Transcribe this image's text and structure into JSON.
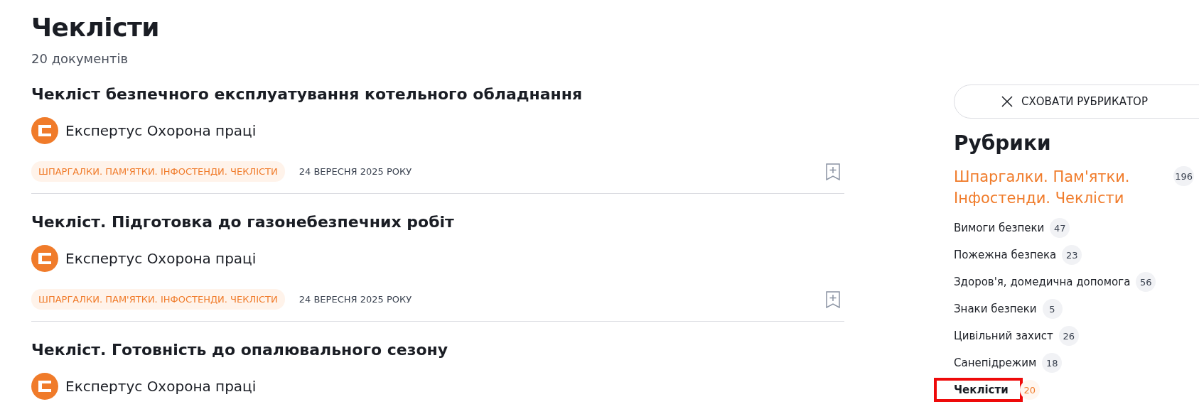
{
  "page": {
    "title": "Чеклісти",
    "subtitle": "20 документів"
  },
  "articles": [
    {
      "title": "Чекліст безпечного експлуатування котельного обладнання",
      "source": "Експертус Охорона праці",
      "tag": "ШПАРГАЛКИ. ПАМ'ЯТКИ. ІНФОСТЕНДИ. ЧЕКЛІСТИ",
      "date": "24 ВЕРЕСНЯ 2025 РОКУ"
    },
    {
      "title": "Чекліст. Підготовка до газонебезпечних робіт",
      "source": "Експертус Охорона праці",
      "tag": "ШПАРГАЛКИ. ПАМ'ЯТКИ. ІНФОСТЕНДИ. ЧЕКЛІСТИ",
      "date": "24 ВЕРЕСНЯ 2025 РОКУ"
    },
    {
      "title": "Чекліст. Готовність до опалювального сезону",
      "source": "Експертус Охорона праці"
    }
  ],
  "sidebar": {
    "hide_button": "СХОВАТИ РУБРИКАТОР",
    "heading": "Рубрики",
    "parent": {
      "label": "Шпаргалки. Пам'ятки. Інфостенди. Чеклісти",
      "count": "196"
    },
    "items": [
      {
        "label": "Вимоги безпеки",
        "count": "47",
        "selected": false
      },
      {
        "label": "Пожежна безпека",
        "count": "23",
        "selected": false
      },
      {
        "label": "Здоров'я, домедична допомога",
        "count": "56",
        "selected": false
      },
      {
        "label": "Знаки безпеки",
        "count": "5",
        "selected": false
      },
      {
        "label": "Цивільний захист",
        "count": "26",
        "selected": false
      },
      {
        "label": "Санепідрежим",
        "count": "18",
        "selected": false
      },
      {
        "label": "Чеклісти",
        "count": "20",
        "selected": true
      }
    ]
  }
}
